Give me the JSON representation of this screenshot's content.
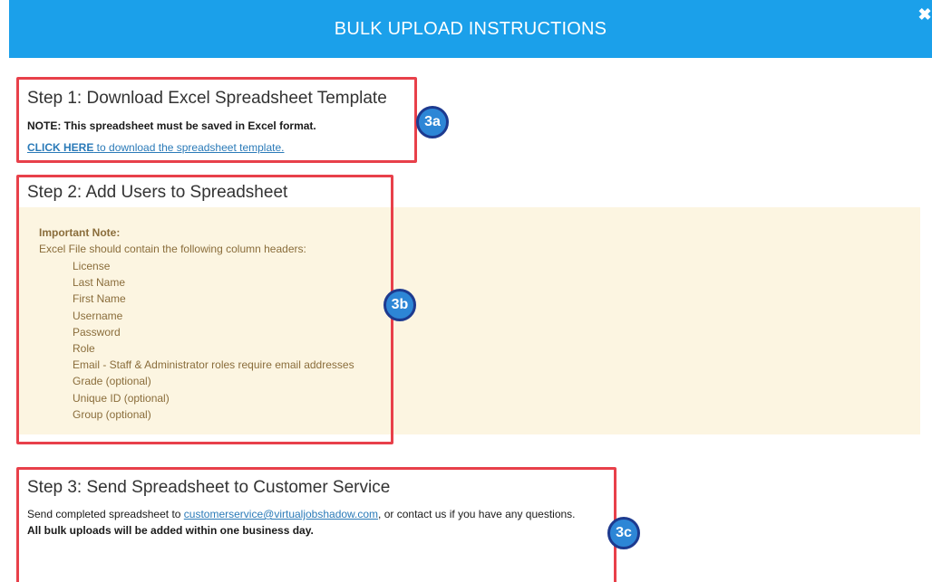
{
  "header": {
    "title": "BULK UPLOAD INSTRUCTIONS",
    "close_glyph": "✖",
    "bg_color": "#1ba0ea"
  },
  "step1": {
    "title": "Step 1: Download Excel Spreadsheet Template",
    "note": "NOTE: This spreadsheet must be saved in Excel format.",
    "link_bold": "CLICK HERE",
    "link_rest": " to download the spreadsheet template.",
    "badge": "3a"
  },
  "step2": {
    "title": "Step 2: Add Users to Spreadsheet",
    "important_label": "Important Note:",
    "description": "Excel File should contain the following column headers:",
    "columns": [
      "License",
      "Last Name",
      "First Name",
      "Username",
      "Password",
      "Role",
      "Email - Staff & Administrator roles require email addresses",
      "Grade (optional)",
      "Unique ID (optional)",
      "Group (optional)"
    ],
    "badge": "3b",
    "note_bg": "#fcf5e1",
    "note_color": "#8a6d3b"
  },
  "step3": {
    "title": "Step 3: Send Spreadsheet to Customer Service",
    "send_prefix": "Send completed spreadsheet to ",
    "email": "customerservice@virtualjobshadow.com",
    "send_suffix": ", or contact us if you have any questions.",
    "bold_line": "All bulk uploads will be added within one business day.",
    "badge": "3c"
  },
  "colors": {
    "highlight_border": "#e8404a",
    "badge_fill": "#2d86d6",
    "badge_border": "#1d3a8f",
    "link": "#2a7ab8"
  }
}
